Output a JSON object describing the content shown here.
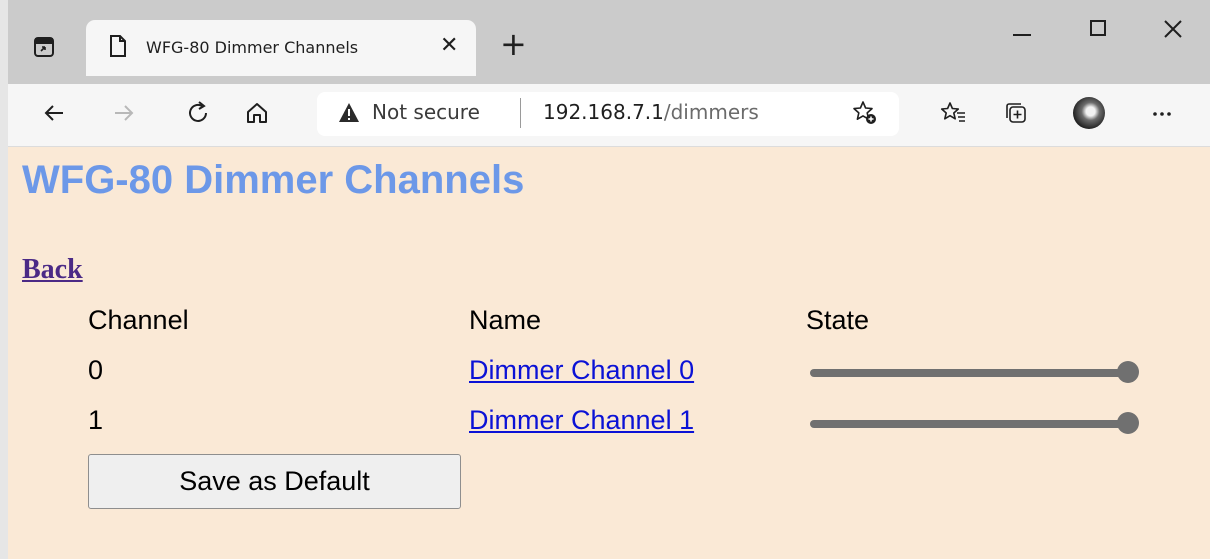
{
  "browser": {
    "tab_title": "WFG-80 Dimmer Channels",
    "address": {
      "security_label": "Not secure",
      "url_host": "192.168.7.1",
      "url_path": "/dimmers"
    },
    "icons": [
      "tab-actions-icon",
      "page-icon",
      "close-tab-icon",
      "new-tab-icon",
      "minimize-icon",
      "maximize-icon",
      "close-window-icon",
      "back-icon",
      "forward-icon",
      "refresh-icon",
      "home-icon",
      "warning-icon",
      "add-favorite-icon",
      "favorites-icon",
      "collections-icon",
      "profile-avatar",
      "more-icon"
    ],
    "colors": {
      "tabstrip": "#cbcbcb",
      "toolbar": "#f6f6f6"
    }
  },
  "page": {
    "heading": "WFG-80 Dimmer Channels",
    "back_link": "Back",
    "table": {
      "headers": {
        "channel": "Channel",
        "name": "Name",
        "state": "State"
      },
      "rows": [
        {
          "channel": "0",
          "name": "Dimmer Channel 0",
          "state_fraction": 1.0
        },
        {
          "channel": "1",
          "name": "Dimmer Channel 1",
          "state_fraction": 1.0
        }
      ]
    },
    "save_button": "Save as Default",
    "colors": {
      "background": "#fae9d6",
      "heading": "#6c98e8",
      "link": "#0b12d6",
      "visited_link": "#4b2a86",
      "slider": "#707070"
    }
  }
}
